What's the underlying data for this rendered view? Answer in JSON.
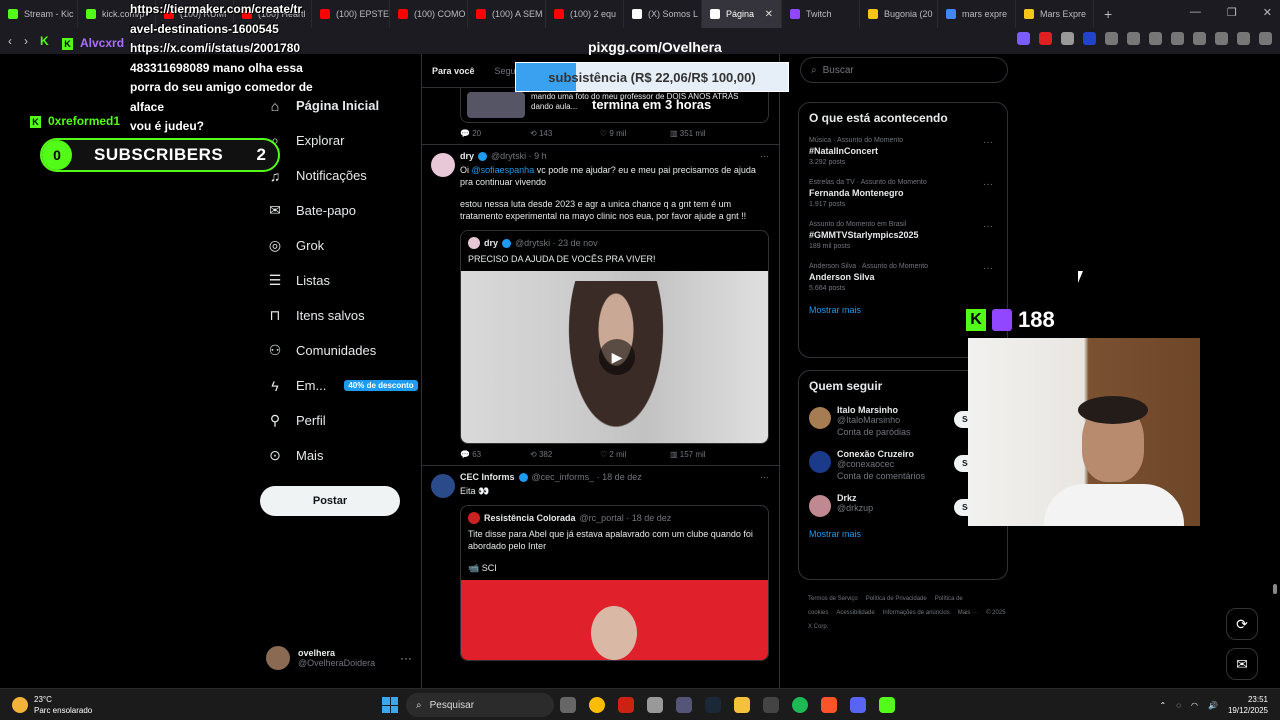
{
  "browser": {
    "tabs": [
      {
        "label": "Stream - Kic",
        "color": "#53fc18"
      },
      {
        "label": "kick.com/p",
        "color": "#53fc18"
      },
      {
        "label": "(100) RUMI",
        "color": "#ff0000"
      },
      {
        "label": "(100) Heartl",
        "color": "#ff0000"
      },
      {
        "label": "(100) EPSTE",
        "color": "#ff0000"
      },
      {
        "label": "(100) COMO",
        "color": "#ff0000"
      },
      {
        "label": "(100) A SEM",
        "color": "#ff0000"
      },
      {
        "label": "(100) 2 equ",
        "color": "#ff0000"
      },
      {
        "label": "(X) Somos L",
        "color": "#ffffff"
      },
      {
        "label": "Página",
        "color": "#ffffff",
        "active": true
      },
      {
        "label": "Twitch",
        "color": "#9146ff"
      },
      {
        "label": "Bugonia (20",
        "color": "#f5c518"
      },
      {
        "label": "mars expre",
        "color": "#4285f4"
      },
      {
        "label": "Mars Expre",
        "color": "#f5c518"
      }
    ],
    "address": "https://x.com/i/status/2001780"
  },
  "overlay": {
    "chat_lines": [
      "https://tiermaker.com/create/tr",
      "avel-destinations-1600545",
      "https://x.com/i/status/2001780",
      "483311698089 mano olha essa",
      "porra do seu amigo comedor de",
      "alface",
      "vou é judeu?"
    ],
    "chat_user": "Alvcxrd",
    "chat_user2": "0xreformed1",
    "subs_left": "0",
    "subs_label": "SUBSCRIBERS",
    "subs_right": "2",
    "pix_url": "pixgg.com/Ovelhera",
    "goal_text": "subsistência (R$ 22,06/R$ 100,00)",
    "goal_progress": 0.2206,
    "ends_text": "termina em 3 horas",
    "viewers": "188"
  },
  "sidebar": {
    "items": [
      {
        "label": "Página Inicial",
        "icon": "home-icon"
      },
      {
        "label": "Explorar",
        "icon": "search-icon"
      },
      {
        "label": "Notificações",
        "icon": "bell-icon"
      },
      {
        "label": "Bate-papo",
        "icon": "mail-icon"
      },
      {
        "label": "Grok",
        "icon": "grok-icon"
      },
      {
        "label": "Listas",
        "icon": "list-icon"
      },
      {
        "label": "Itens salvos",
        "icon": "bookmark-icon"
      },
      {
        "label": "Comunidades",
        "icon": "people-icon"
      },
      {
        "label": "Em...",
        "icon": "bolt-icon",
        "badge": "40% de desconto"
      },
      {
        "label": "Perfil",
        "icon": "person-icon"
      },
      {
        "label": "Mais",
        "icon": "more-icon"
      }
    ],
    "post_label": "Postar",
    "profile_name": "ovelhera",
    "profile_handle": "@OvelheraDoidera"
  },
  "feed": {
    "tabs": [
      "Para você",
      "Seguindo"
    ],
    "prev_tweet": {
      "quote_text": "mando uma foto do meu professor de DOIS ANOS ATRÁS dando aula...",
      "metrics": [
        "20",
        "143",
        "9 mil",
        "351 mil"
      ]
    },
    "tweet1": {
      "name": "dry",
      "handle": "@drytski · 9 h",
      "mention": "@sofiaespanha",
      "text_pre": "Oi ",
      "text_post": " vc pode me ajudar? eu e meu pai precisamos de ajuda pra continuar vivendo",
      "text2": "estou nessa luta desde 2023 e agr a unica chance q a gnt tem é um tratamento experimental na mayo clinic nos eua, por favor ajude a gnt !!",
      "quote_name": "dry",
      "quote_handle": "@drytski · 23 de nov",
      "quote_text": "PRECISO DA AJUDA DE VOCÊS PRA VIVER!",
      "metrics": [
        "63",
        "382",
        "2 mil",
        "157 mil"
      ]
    },
    "tweet2": {
      "name": "CEC Informs",
      "handle": "@cec_informs_ · 18 de dez",
      "text": "Eita 👀",
      "quote_name": "Resistência Colorada",
      "quote_handle": "@rc_portal · 18 de dez",
      "quote_text": "Tite disse para Abel que já estava apalavrado com um clube quando foi abordado pelo Inter",
      "quote_text2": "📹 SCI"
    }
  },
  "right": {
    "search_placeholder": "Buscar",
    "trends_title": "O que está acontecendo",
    "trends": [
      {
        "cat": "Música · Assunto do Momento",
        "name": "#NatalInConcert",
        "count": "3.292 posts"
      },
      {
        "cat": "Estrelas da TV · Assunto do Momento",
        "name": "Fernanda Montenegro",
        "count": "1.917 posts"
      },
      {
        "cat": "Assunto do Momento em Brasil",
        "name": "#GMMTVStarlympics2025",
        "count": "189 mil posts"
      },
      {
        "cat": "Anderson Silva · Assunto do Momento",
        "name": "Anderson Silva",
        "count": "5.664 posts"
      }
    ],
    "show_more": "Mostrar mais",
    "follow_title": "Quem seguir",
    "follow": [
      {
        "name": "Italo Marsinho",
        "handle": "@ItaloMarsinho",
        "sub": "Conta de paródias",
        "btn": "Seguir"
      },
      {
        "name": "Conexão Cruzeiro",
        "handle": "@conexaocec",
        "sub": "Conta de comentários",
        "btn": "Seguir"
      },
      {
        "name": "Drkz",
        "handle": "@drkzup",
        "sub": "",
        "btn": "Seguir"
      }
    ],
    "show_more2": "Mostrar mais",
    "footer": [
      "Termos de Serviço",
      "Política de Privacidade",
      "Política de cookies",
      "Acessibilidade",
      "Informações de anúncios",
      "Mais ···",
      "© 2025 X Corp."
    ]
  },
  "taskbar": {
    "temp": "23°C",
    "weather": "Parc ensolarado",
    "search": "Pesquisar",
    "time": "23:51",
    "date": "19/12/2025"
  }
}
